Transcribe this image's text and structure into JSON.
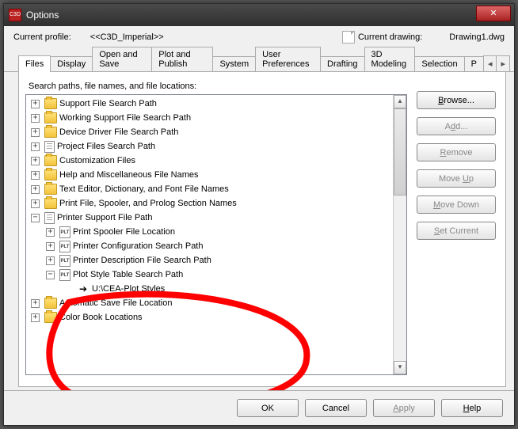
{
  "window_title": "Options",
  "header": {
    "profile_label": "Current profile:",
    "profile_value": "<<C3D_Imperial>>",
    "drawing_label": "Current drawing:",
    "drawing_value": "Drawing1.dwg"
  },
  "tabs": [
    "Files",
    "Display",
    "Open and Save",
    "Plot and Publish",
    "System",
    "User Preferences",
    "Drafting",
    "3D Modeling",
    "Selection",
    "P"
  ],
  "active_tab": 0,
  "panel_caption": "Search paths, file names, and file locations:",
  "tree": [
    {
      "level": 0,
      "exp": "+",
      "icon": "folder",
      "label": "Support File Search Path"
    },
    {
      "level": 0,
      "exp": "+",
      "icon": "folder",
      "label": "Working Support File Search Path"
    },
    {
      "level": 0,
      "exp": "+",
      "icon": "folder",
      "label": "Device Driver File Search Path"
    },
    {
      "level": 0,
      "exp": "+",
      "icon": "doc",
      "label": "Project Files Search Path"
    },
    {
      "level": 0,
      "exp": "+",
      "icon": "folder",
      "label": "Customization Files"
    },
    {
      "level": 0,
      "exp": "+",
      "icon": "folder",
      "label": "Help and Miscellaneous File Names"
    },
    {
      "level": 0,
      "exp": "+",
      "icon": "folder",
      "label": "Text Editor, Dictionary, and Font File Names"
    },
    {
      "level": 0,
      "exp": "+",
      "icon": "folder",
      "label": "Print File, Spooler, and Prolog Section Names"
    },
    {
      "level": 0,
      "exp": "−",
      "icon": "doc",
      "label": "Printer Support File Path"
    },
    {
      "level": 1,
      "exp": "+",
      "icon": "plt",
      "label": "Print Spooler File Location"
    },
    {
      "level": 1,
      "exp": "+",
      "icon": "plt",
      "label": "Printer Configuration Search Path"
    },
    {
      "level": 1,
      "exp": "+",
      "icon": "plt",
      "label": "Printer Description File Search Path"
    },
    {
      "level": 1,
      "exp": "−",
      "icon": "plt",
      "label": "Plot Style Table Search Path"
    },
    {
      "level": 2,
      "exp": "",
      "icon": "arrow",
      "label": "U:\\CEA-Plot Styles"
    },
    {
      "level": 0,
      "exp": "+",
      "icon": "folder",
      "label": "Automatic Save File Location"
    },
    {
      "level": 0,
      "exp": "+",
      "icon": "folder",
      "label": "Color Book Locations"
    }
  ],
  "buttons": {
    "browse": "Browse...",
    "add": "Add...",
    "remove": "Remove",
    "moveup": "Move Up",
    "movedown": "Move Down",
    "setcurrent": "Set Current"
  },
  "footer": {
    "ok": "OK",
    "cancel": "Cancel",
    "apply": "Apply",
    "help": "Help"
  }
}
